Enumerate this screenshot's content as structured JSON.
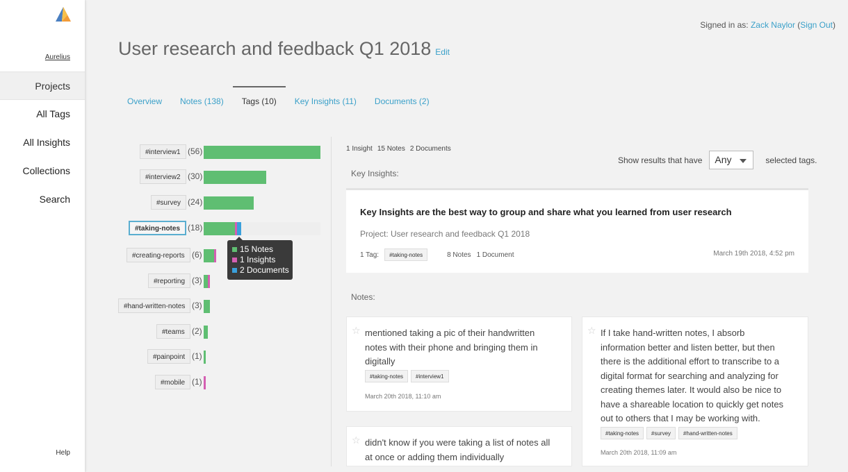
{
  "brand": {
    "name": "Aurelius"
  },
  "sidebar": {
    "items": [
      {
        "label": "Projects"
      },
      {
        "label": "All Tags"
      },
      {
        "label": "All Insights"
      },
      {
        "label": "Collections"
      },
      {
        "label": "Search"
      }
    ],
    "help": "Help"
  },
  "header": {
    "signed_prefix": "Signed in as: ",
    "user": "Zack Naylor",
    "signout_open": " (",
    "signout": "Sign Out",
    "signout_close": ")",
    "title": "User research and feedback Q1 2018",
    "edit": "Edit"
  },
  "tabs": [
    {
      "label": "Overview"
    },
    {
      "label": "Notes (138)"
    },
    {
      "label": "Tags (10)"
    },
    {
      "label": "Key Insights (11)"
    },
    {
      "label": "Documents (2)"
    }
  ],
  "colors": {
    "notes": "#5fbe72",
    "insights": "#d45fb2",
    "documents": "#3aa0dc",
    "accent": "#3aa0c9"
  },
  "tags": [
    {
      "name": "#interview1",
      "count": "(56)",
      "notes": 56,
      "insights": 0,
      "documents": 0
    },
    {
      "name": "#interview2",
      "count": "(30)",
      "notes": 30,
      "insights": 0,
      "documents": 0
    },
    {
      "name": "#survey",
      "count": "(24)",
      "notes": 24,
      "insights": 0,
      "documents": 0
    },
    {
      "name": "#taking-notes",
      "count": "(18)",
      "notes": 15,
      "insights": 1,
      "documents": 2
    },
    {
      "name": "#creating-reports",
      "count": "(6)",
      "notes": 5,
      "insights": 1,
      "documents": 0
    },
    {
      "name": "#reporting",
      "count": "(3)",
      "notes": 2,
      "insights": 1,
      "documents": 0
    },
    {
      "name": "#hand-written-notes",
      "count": "(3)",
      "notes": 3,
      "insights": 0,
      "documents": 0
    },
    {
      "name": "#teams",
      "count": "(2)",
      "notes": 2,
      "insights": 0,
      "documents": 0
    },
    {
      "name": "#painpoint",
      "count": "(1)",
      "notes": 1,
      "insights": 0,
      "documents": 0
    },
    {
      "name": "#mobile",
      "count": "(1)",
      "notes": 0,
      "insights": 1,
      "documents": 0
    }
  ],
  "tooltip": {
    "notes": "15 Notes",
    "insights": "1 Insights",
    "documents": "2 Documents"
  },
  "summary": {
    "insights": "1 Insight",
    "notes": "15 Notes",
    "documents": "2 Documents"
  },
  "filter": {
    "prefix": "Show results that have",
    "value": "Any",
    "suffix": "selected tags."
  },
  "key_insights_label": "Key Insights:",
  "key_insight": {
    "title": "Key Insights are the best way to group and share what you learned from user research",
    "project": "Project: User research and feedback Q1 2018",
    "tag_label": "1 Tag:",
    "tag": "#taking-notes",
    "notes": "8 Notes",
    "documents": "1 Document",
    "date": "March 19th 2018, 4:52 pm"
  },
  "notes_label": "Notes:",
  "notes": [
    {
      "lines": [
        "mentioned taking a pic of their handwritten",
        "notes with their phone and bringing them in",
        "digitally"
      ],
      "tags": [
        "#taking-notes",
        "#interview1"
      ],
      "date": "March 20th 2018, 11:10 am"
    },
    {
      "lines": [
        "If I take hand-written notes, I absorb",
        "information better and listen better, but then",
        "there is the additional effort to transcribe to a",
        "digital format for searching and analyzing for",
        "creating themes later. It would also be nice to",
        "have a shareable location to quickly get notes",
        "out to others that I may be working with."
      ],
      "tags": [
        "#taking-notes",
        "#survey",
        "#hand-written-notes"
      ],
      "date": "March 20th 2018, 11:09 am"
    },
    {
      "lines": [
        "didn't know if you were taking a list of notes all",
        "at once or adding them individually"
      ],
      "tags": [],
      "date": ""
    }
  ]
}
